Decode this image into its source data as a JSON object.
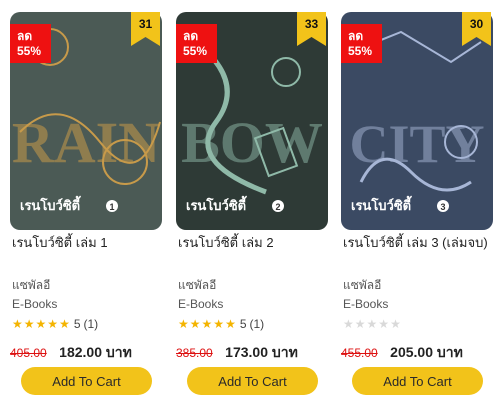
{
  "products": [
    {
      "cover_text": "RAIN",
      "cover_title_th": "เรนโบว์ซิตี้",
      "cover_vol": "1",
      "cover_bg": "#4b5a55",
      "cover_accent": "#c79a4a",
      "discount_label": "ลด",
      "discount_pct": "55%",
      "badge_number": "31",
      "title": "เรนโบว์ซิตี้ เล่ม 1",
      "author": "แซพัลอี",
      "category": "E-Books",
      "rating": 5,
      "rating_text": "5",
      "review_count": "(1)",
      "old_price": "405.00",
      "new_price": "182.00 บาท",
      "button_label": "Add To Cart"
    },
    {
      "cover_text": "BOW",
      "cover_title_th": "เรนโบว์ซิตี้",
      "cover_vol": "2",
      "cover_bg": "#2e3a36",
      "cover_accent": "#8fb9a8",
      "discount_label": "ลด",
      "discount_pct": "55%",
      "badge_number": "33",
      "title": "เรนโบว์ซิตี้ เล่ม 2",
      "author": "แซพัลอี",
      "category": "E-Books",
      "rating": 5,
      "rating_text": "5",
      "review_count": "(1)",
      "old_price": "385.00",
      "new_price": "173.00 บาท",
      "button_label": "Add To Cart"
    },
    {
      "cover_text": "CITY",
      "cover_title_th": "เรนโบว์ซิตี้",
      "cover_vol": "3",
      "cover_bg": "#3b4a63",
      "cover_accent": "#a7b6d6",
      "discount_label": "ลด",
      "discount_pct": "55%",
      "badge_number": "30",
      "title": "เรนโบว์ซิตี้ เล่ม 3 (เล่มจบ)",
      "author": "แซพัลอี",
      "category": "E-Books",
      "rating": 0,
      "rating_text": "",
      "review_count": "",
      "old_price": "455.00",
      "new_price": "205.00 บาท",
      "button_label": "Add To Cart"
    }
  ],
  "colors": {
    "discount": "#ee1111",
    "badge": "#f2c31a",
    "button": "#f2c31a",
    "star": "#f4b400",
    "old_price": "#d11111"
  }
}
